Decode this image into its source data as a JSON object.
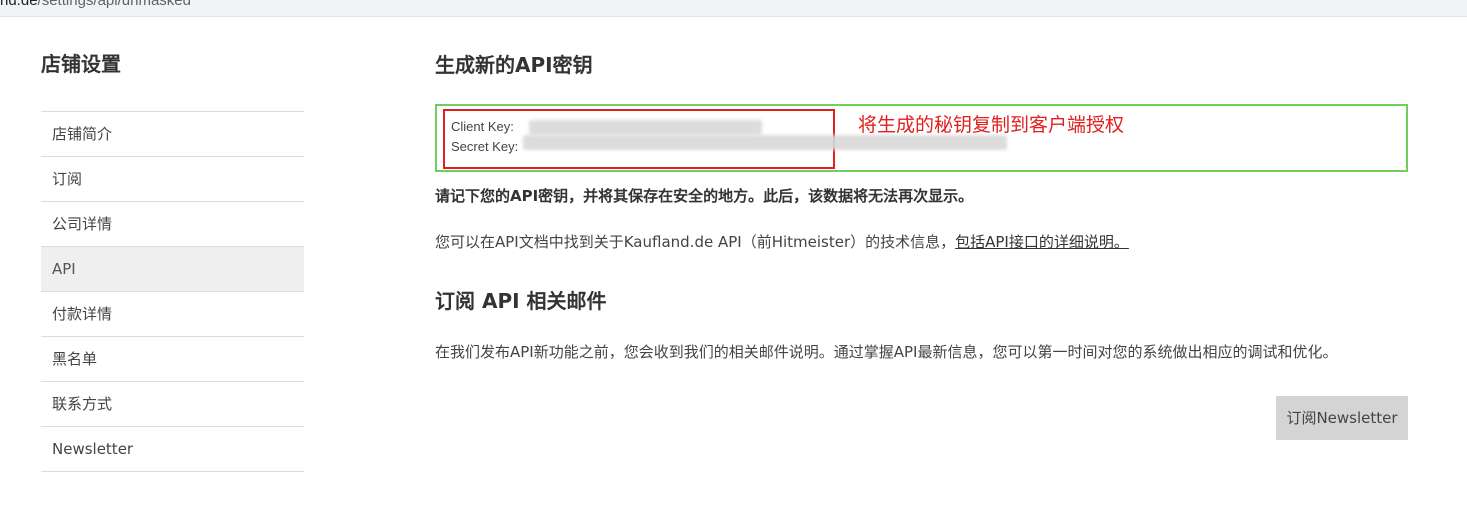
{
  "browser": {
    "url_host": "nd.de",
    "url_path": "/settings/api/unmasked"
  },
  "sidebar": {
    "title": "店铺设置",
    "items": [
      {
        "label": "店铺简介"
      },
      {
        "label": "订阅"
      },
      {
        "label": "公司详情"
      },
      {
        "label": "API"
      },
      {
        "label": "付款详情"
      },
      {
        "label": "黑名单"
      },
      {
        "label": "联系方式"
      },
      {
        "label": "Newsletter"
      }
    ],
    "active_index": 3
  },
  "main": {
    "generate_title": "生成新的API密钥",
    "client_key_label": "Client Key:",
    "secret_key_label": "Secret Key:",
    "annotation": "将生成的秘钥复制到客户端授权",
    "warning": "请记下您的API密钥，并将其保存在安全的地方。此后，该数据将无法再次显示。",
    "info_text": "您可以在API文档中找到关于Kaufland.de API（前Hitmeister）的技术信息，",
    "info_link": "包括API接口的详细说明。",
    "subscribe_title": "订阅 API 相关邮件",
    "subscribe_desc": "在我们发布API新功能之前，您会收到我们的相关邮件说明。通过掌握API最新信息，您可以第一时间对您的系统做出相应的调试和优化。",
    "subscribe_button": "订阅Newsletter"
  },
  "colors": {
    "highlight_green": "#6fcf5a",
    "highlight_red": "#e02020",
    "button_bg": "#d4d4d4",
    "active_item_bg": "#efefef"
  }
}
